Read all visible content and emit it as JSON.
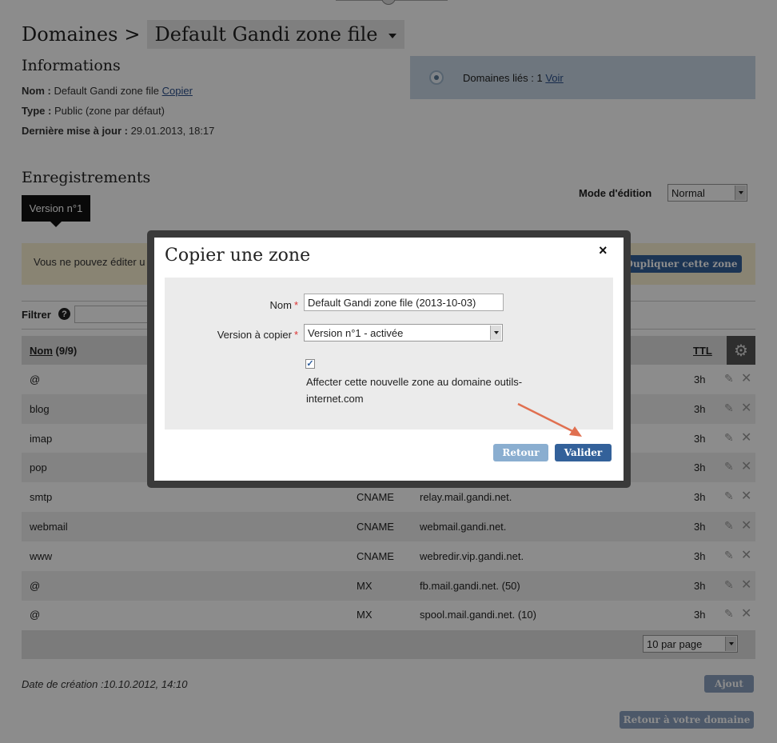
{
  "breadcrumb": {
    "root": "Domaines",
    "separator": ">",
    "current": "Default Gandi zone file"
  },
  "informations": {
    "heading": "Informations",
    "nom_label": "Nom :",
    "nom_value": "Default Gandi zone file",
    "copier_link": "Copier",
    "type_label": "Type :",
    "type_value": "Public (zone par défaut)",
    "update_label": "Dernière mise à jour :",
    "update_value": "29.01.2013, 18:17"
  },
  "linked": {
    "text": "Domaines liés : 1",
    "link": "Voir"
  },
  "records": {
    "heading": "Enregistrements",
    "version_tab": "Version n°1",
    "mode_label": "Mode d'édition",
    "mode_value": "Normal",
    "warning": "Vous ne pouvez éditer u",
    "duplicate_button": "Dupliquer cette zone",
    "filter_label": "Filtrer",
    "help": "?",
    "col_name": "Nom",
    "col_count": "(9/9)",
    "col_ttl": "TTL",
    "rows": [
      {
        "name": "@",
        "type": "",
        "value": "",
        "ttl": "3h"
      },
      {
        "name": "blog",
        "type": "",
        "value": "",
        "ttl": "3h"
      },
      {
        "name": "imap",
        "type": "",
        "value": "",
        "ttl": "3h"
      },
      {
        "name": "pop",
        "type": "",
        "value": "",
        "ttl": "3h"
      },
      {
        "name": "smtp",
        "type": "CNAME",
        "value": "relay.mail.gandi.net.",
        "ttl": "3h"
      },
      {
        "name": "webmail",
        "type": "CNAME",
        "value": "webmail.gandi.net.",
        "ttl": "3h"
      },
      {
        "name": "www",
        "type": "CNAME",
        "value": "webredir.vip.gandi.net.",
        "ttl": "3h"
      },
      {
        "name": "@",
        "type": "MX",
        "value": "fb.mail.gandi.net. (50)",
        "ttl": "3h"
      },
      {
        "name": "@",
        "type": "MX",
        "value": "spool.mail.gandi.net. (10)",
        "ttl": "3h"
      }
    ],
    "per_page": "10 par page"
  },
  "footer": {
    "created": "Date de création :10.10.2012, 14:10",
    "add_button": "Ajout",
    "back_button": "Retour à votre domaine"
  },
  "modal": {
    "title": "Copier une zone",
    "close": "×",
    "name_label": "Nom",
    "name_value": "Default Gandi zone file (2013-10-03)",
    "version_label": "Version à copier",
    "version_value": "Version n°1 - activée",
    "checkbox_text": "Affecter cette nouvelle zone au domaine outils-internet.com",
    "back_button": "Retour",
    "submit_button": "Valider"
  },
  "colors": {
    "accent": "#33619a",
    "annotation_arrow": "#e07050"
  }
}
